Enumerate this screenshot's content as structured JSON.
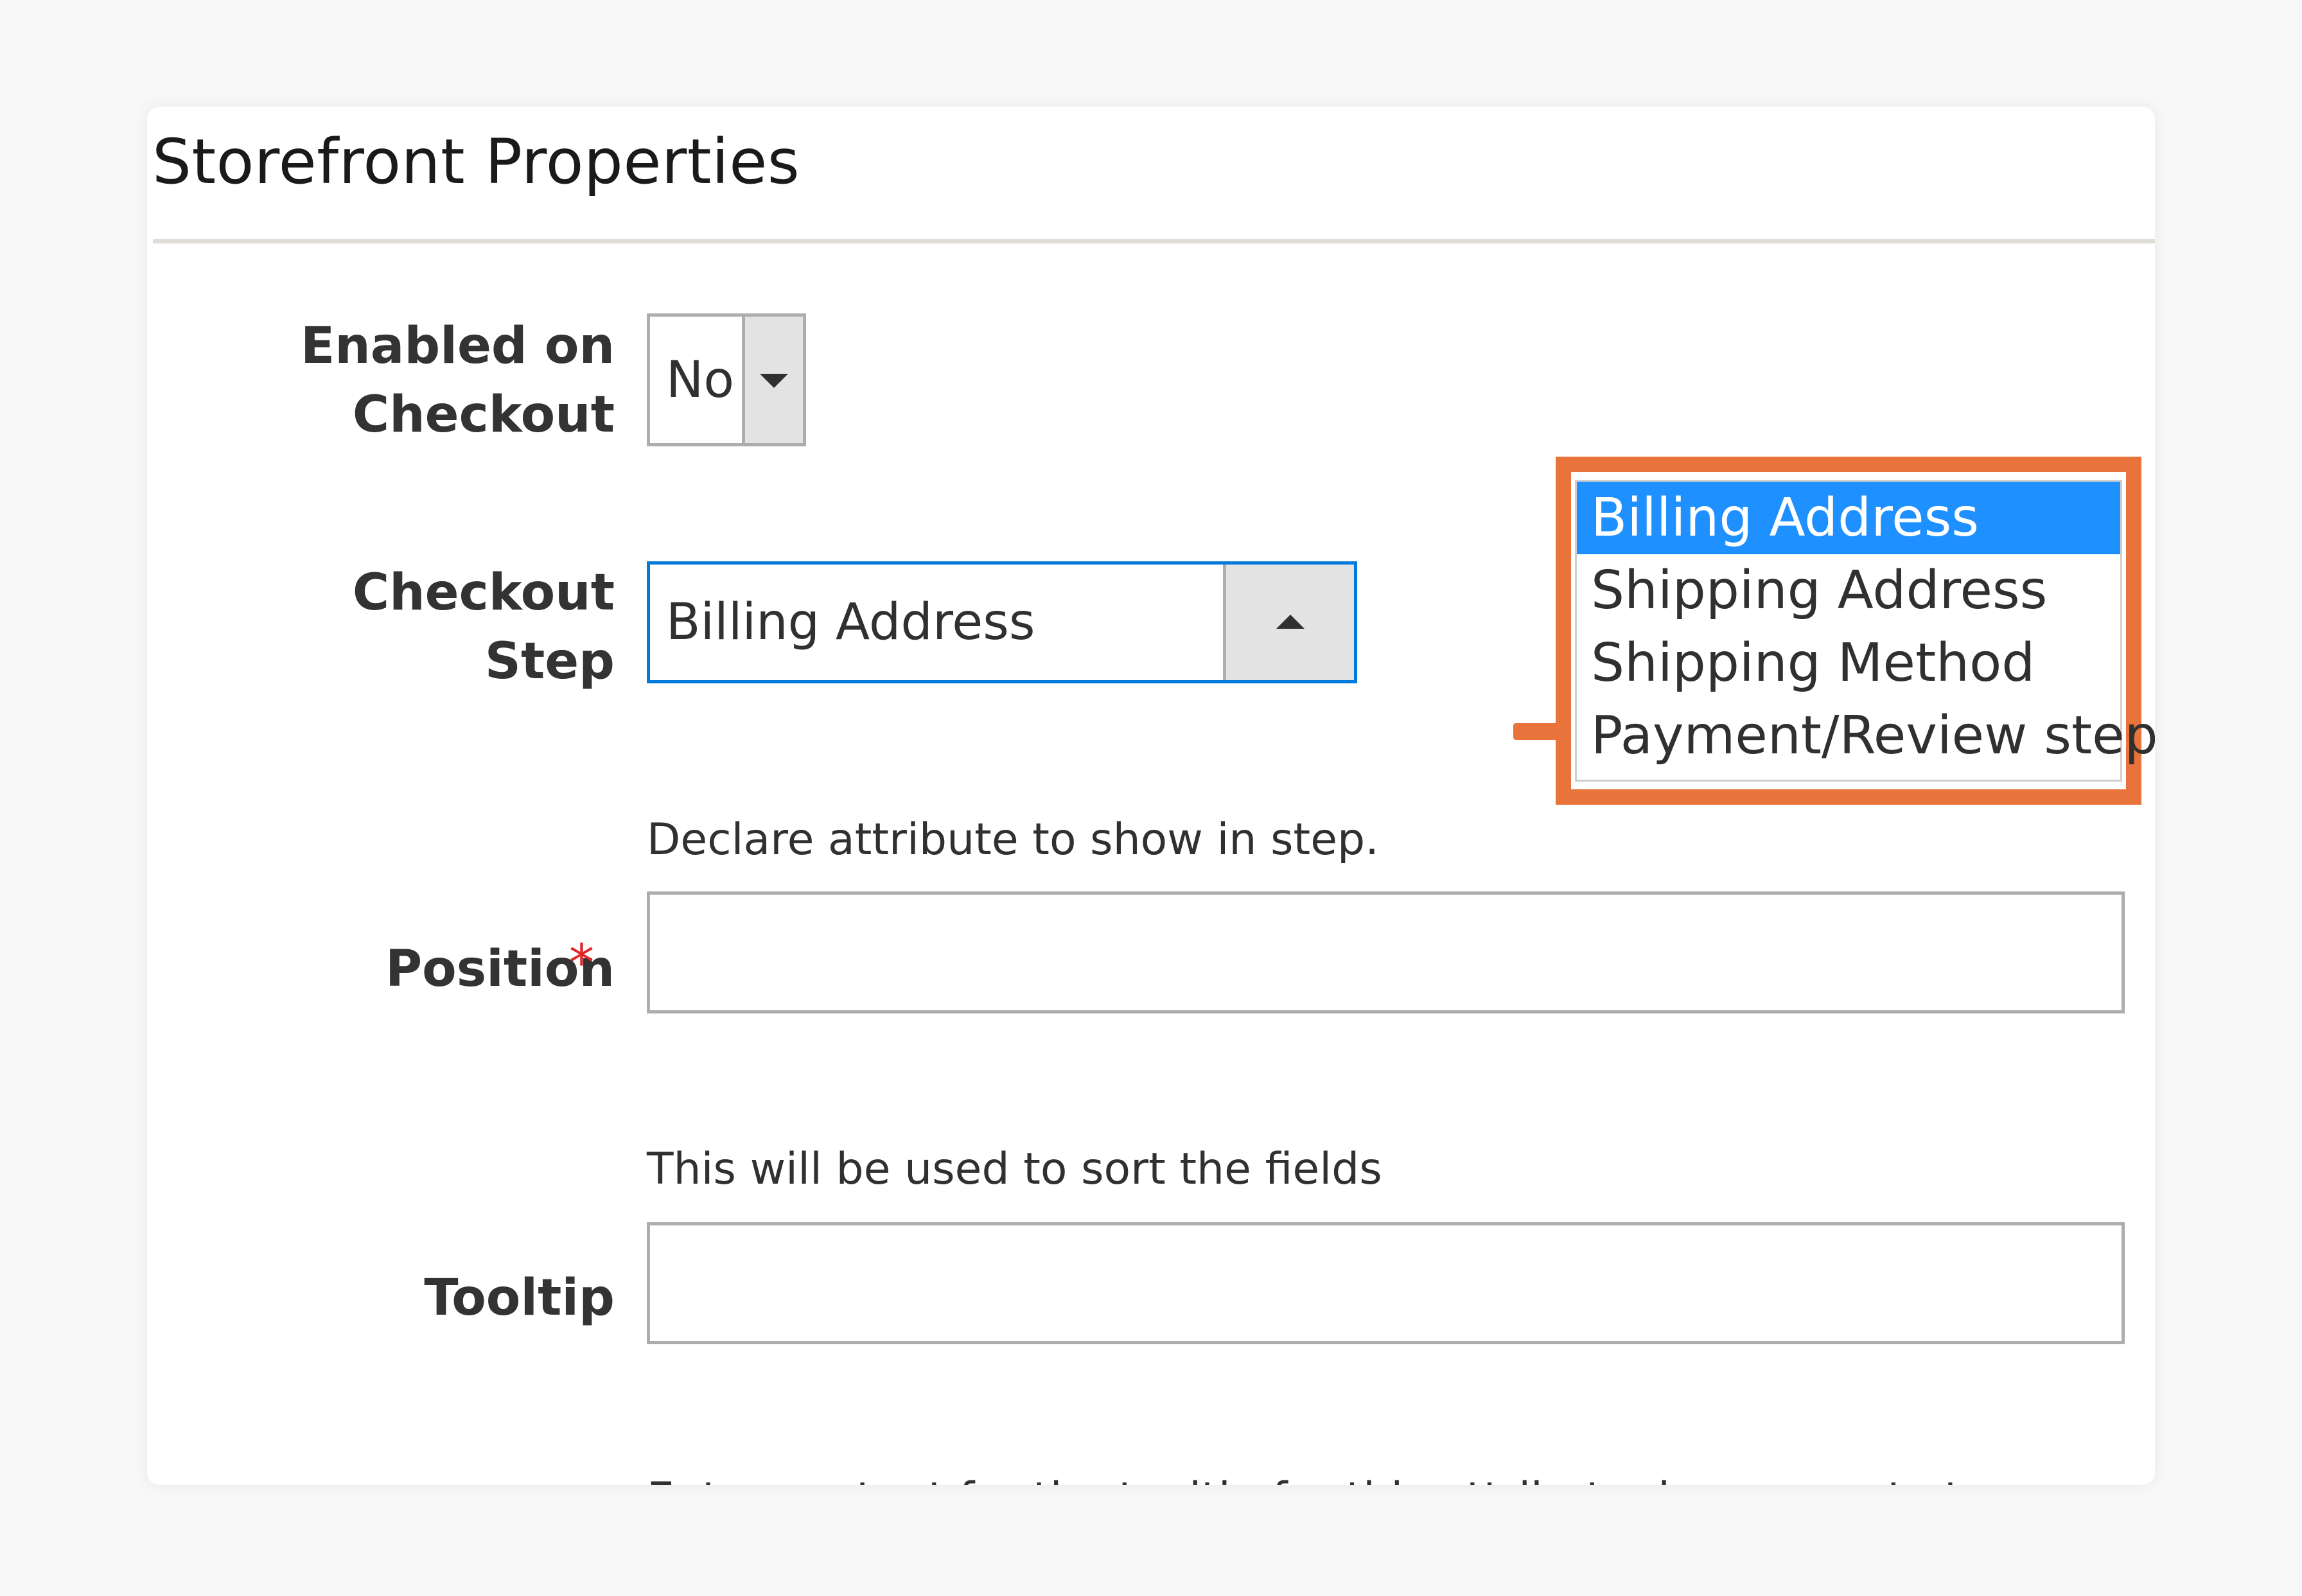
{
  "section": {
    "title": "Storefront Properties"
  },
  "fields": {
    "enabled_on_checkout": {
      "label_line1": "Enabled on",
      "label_line2": "Checkout",
      "value": "No"
    },
    "checkout_step": {
      "label_line1": "Checkout",
      "label_line2": "Step",
      "value": "Billing Address",
      "note": "Declare attribute to show in step."
    },
    "position": {
      "label": "Position",
      "required_mark": "*",
      "value": "",
      "note": "This will be used to sort the fields"
    },
    "tooltip": {
      "label": "Tooltip",
      "value": "",
      "note": "Enter content for the tooltip for this attribute, leave empty to disable tooltip"
    }
  },
  "checkout_step_options": [
    {
      "label": "Billing Address",
      "selected": true
    },
    {
      "label": "Shipping Address",
      "selected": false
    },
    {
      "label": "Shipping Method",
      "selected": false
    },
    {
      "label": "Payment/Review step",
      "selected": false
    }
  ],
  "colors": {
    "accent_orange": "#e8743b",
    "selected_option": "#1e90ff",
    "focus_border": "#007bdb",
    "required_star": "#e22626"
  },
  "icons": {
    "enabled_select_caret": "chevron-down-icon",
    "checkout_step_caret": "chevron-up-icon",
    "callout_arrow": "arrow-right-icon"
  }
}
